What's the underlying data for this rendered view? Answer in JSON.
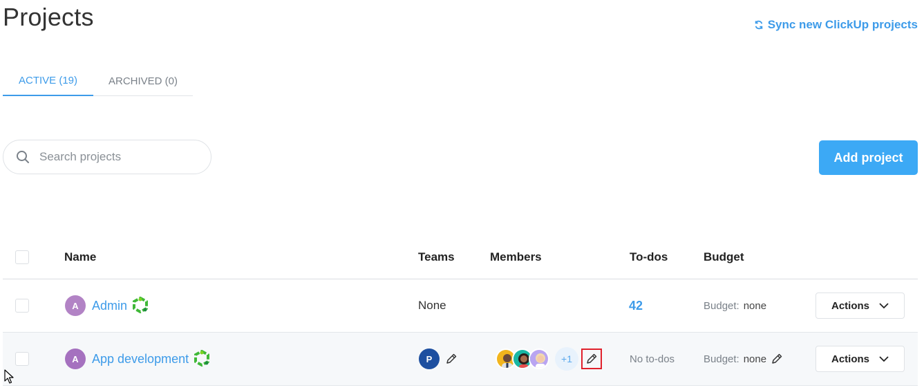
{
  "header": {
    "title": "Projects",
    "sync_label": "Sync new ClickUp projects"
  },
  "tabs": [
    {
      "label": "ACTIVE (19)",
      "active": true
    },
    {
      "label": "ARCHIVED (0)",
      "active": false
    }
  ],
  "search": {
    "placeholder": "Search projects",
    "value": ""
  },
  "add_button": {
    "label": "Add project"
  },
  "colors": {
    "accent": "#3d9be9",
    "button": "#3ca9f5",
    "highlight": "#e0202b"
  },
  "table": {
    "columns": [
      "Name",
      "Teams",
      "Members",
      "To-dos",
      "Budget"
    ],
    "rows": [
      {
        "initial": "A",
        "name": "Admin",
        "teams": "None",
        "todos": "42",
        "budget_label": "Budget:",
        "budget_value": "none",
        "actions_label": "Actions"
      },
      {
        "initial": "A",
        "name": "App development",
        "team_initial": "P",
        "members_more": "+1",
        "todos": "No to-dos",
        "budget_label": "Budget:",
        "budget_value": "none",
        "actions_label": "Actions"
      }
    ]
  },
  "icons": [
    "sync-icon",
    "search-icon",
    "clickup-icon",
    "pencil-icon",
    "chevron-down-icon",
    "cursor-arrow-icon"
  ]
}
